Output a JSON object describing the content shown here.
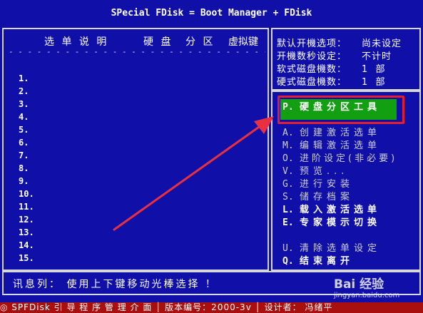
{
  "title": "SPecial FDisk = Boot Manager + FDisk",
  "left": {
    "headers": [
      "选 单 说 明",
      "硬 盘",
      "分 区",
      "虚拟键"
    ],
    "dashes": "- - - - - - - - - - - - - - - - - - - - - - - - - - - - - - - - - - - - - - - - - - - - - - - - - -",
    "numbers": [
      "1.",
      "2.",
      "3.",
      "4.",
      "5.",
      "6.",
      "7.",
      "8.",
      "9.",
      "10.",
      "11.",
      "12.",
      "13.",
      "14.",
      "15."
    ]
  },
  "info": [
    {
      "label": "默认开機选项：",
      "value": "尚未设定"
    },
    {
      "label": "开機数秒设定：",
      "value": "不计时"
    },
    {
      "label": "软式磁盘機数：",
      "value": "1  部"
    },
    {
      "label": "硬式磁盘機数：",
      "value": "1  部"
    }
  ],
  "menu": [
    {
      "key": "P.",
      "label": "硬盘分区工具",
      "highlight": true
    },
    {
      "key": "A.",
      "label": "创建激活选单"
    },
    {
      "key": "M.",
      "label": "编辑激活选单"
    },
    {
      "key": "O.",
      "label": "进阶设定(非必要)"
    },
    {
      "key": "V.",
      "label": "预览..."
    },
    {
      "key": "G.",
      "label": "进行安装"
    },
    {
      "key": "S.",
      "label": "储存档案"
    },
    {
      "key": "L.",
      "label": "载入激活选单",
      "bold": true
    },
    {
      "key": "E.",
      "label": "专家模示切换",
      "bold": true
    },
    {
      "key": "U.",
      "label": "清除选单设定"
    },
    {
      "key": "Q.",
      "label": "结束离开",
      "bold": true
    }
  ],
  "message": "讯息列： 使用上下键移动光棒选择 ！",
  "status": "◎ SPFDisk 引 导 程 序 管 理 介 面  │ 版本编号：2000-3v │ 设计者： 冯绪平",
  "watermark": {
    "brand": "Bai 经验",
    "url": "jingyan.baidu.com"
  },
  "colors": {
    "background": "#1010a8",
    "highlight": "#12a012",
    "statusbar": "#a81010",
    "annotation": "#e02030"
  }
}
